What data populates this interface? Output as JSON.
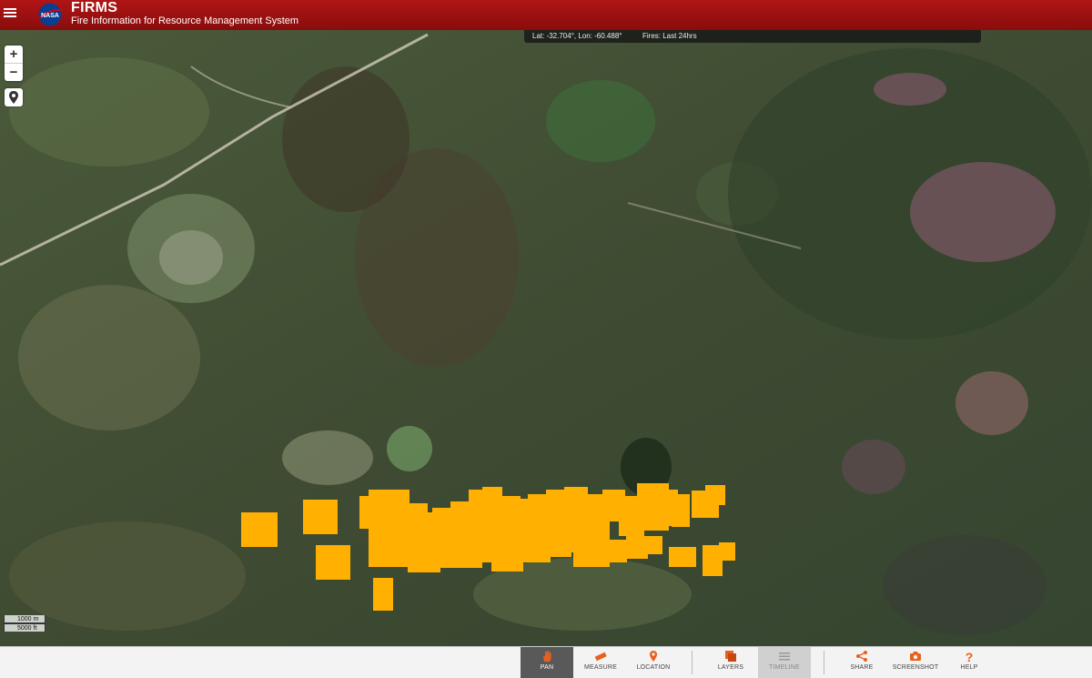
{
  "header": {
    "title": "FIRMS",
    "subtitle": "Fire Information for Resource Management System",
    "logo_text": "NASA",
    "color": "#a01010"
  },
  "coords": {
    "position": "Lat: -32.704°, Lon: -60.488°",
    "fires": "Fires: Last 24hrs"
  },
  "map_controls": {
    "zoom_in": "+",
    "zoom_out": "−"
  },
  "scale": {
    "metric": "1000 m",
    "imperial": "5000 ft"
  },
  "fire_color": "#ffb000",
  "toolbar": {
    "pan": "PAN",
    "measure": "MEASURE",
    "location": "LOCATION",
    "layers": "LAYERS",
    "timeline": "TIMELINE",
    "share": "SHARE",
    "screenshot": "SCREENSHOT",
    "help": "HELP",
    "accent": "#e8601c"
  }
}
